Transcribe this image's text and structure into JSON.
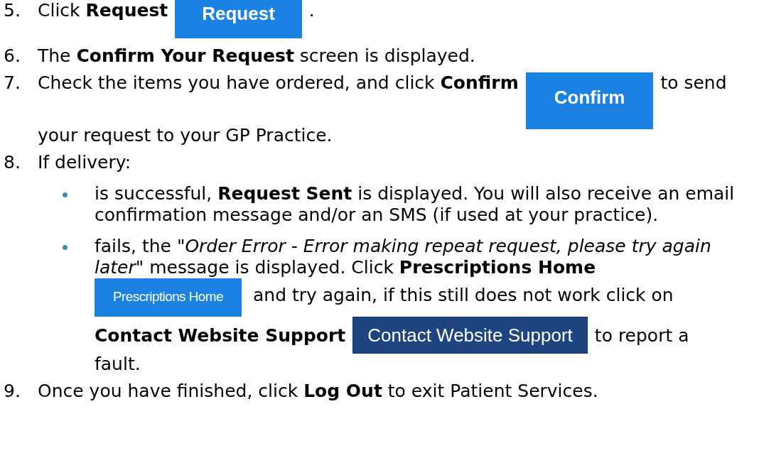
{
  "steps": [
    {
      "number": "5.",
      "lines": [
        [
          {
            "kind": "text",
            "text": "Click **Request**"
          },
          {
            "kind": "bigbutton",
            "label": "Request"
          },
          {
            "kind": "text",
            "text": "."
          }
        ]
      ]
    },
    {
      "number": "6.",
      "lines": [
        [
          {
            "kind": "text",
            "text": "The **Confirm Your Request** screen is displayed."
          }
        ]
      ]
    },
    {
      "number": "7.",
      "lines": [
        [
          {
            "kind": "text",
            "text": "Check the items you have ordered, and click **Confirm**"
          },
          {
            "kind": "tallbutton",
            "label": "Confirm"
          },
          {
            "kind": "text",
            "text": "to send"
          }
        ],
        [
          {
            "kind": "text",
            "text": "your request to your GP Practice."
          }
        ]
      ]
    },
    {
      "number": "8.",
      "lines": [
        [
          {
            "kind": "text",
            "text": "If delivery:"
          }
        ]
      ],
      "bullets": [
        {
          "lines": [
            [
              {
                "kind": "text",
                "text": "is successful, **Request Sent** is displayed. You will also receive an email confirmation message and/or an SMS (if used at your practice)."
              }
            ]
          ]
        },
        {
          "lines": [
            [
              {
                "kind": "text",
                "text": "fails, the \"*Order Error - Error making repeat request, please try again*"
              }
            ],
            [
              {
                "kind": "text",
                "text": "*later*\" message is displayed. Click **Prescriptions Home**"
              }
            ],
            [
              {
                "kind": "smallbutton",
                "label": "Prescriptions Home"
              },
              {
                "kind": "text",
                "text": "and try again, if this still does not work click on"
              }
            ],
            [
              {
                "kind": "text",
                "text": "**Contact Website Support**"
              },
              {
                "kind": "darkbutton",
                "label": "Contact Website Support"
              },
              {
                "kind": "text",
                "text": "to report a"
              }
            ],
            [
              {
                "kind": "text",
                "text": "fault."
              }
            ]
          ]
        }
      ]
    },
    {
      "number": "9.",
      "lines": [
        [
          {
            "kind": "text",
            "text": "Once you have finished, click **Log Out** to exit Patient Services."
          }
        ]
      ]
    }
  ]
}
